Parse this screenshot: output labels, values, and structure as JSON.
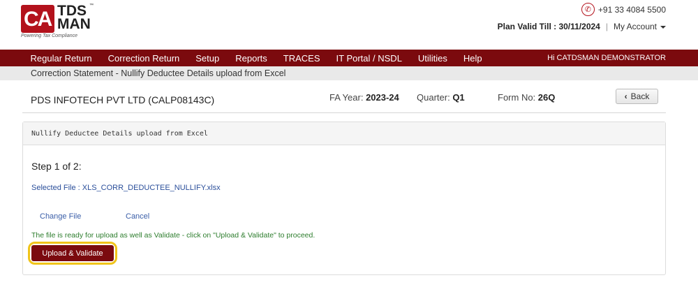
{
  "brand": {
    "logo_ca": "CA",
    "logo_tds": "TDS",
    "logo_man": "MAN",
    "trademark": "™",
    "tagline": "Powering Tax Compliance"
  },
  "header": {
    "phone": "+91 33 4084 5500",
    "plan_label": "Plan Valid Till : 30/11/2024",
    "separator": "|",
    "account_label": "My Account"
  },
  "nav": {
    "items": [
      {
        "label": "Regular Return"
      },
      {
        "label": "Correction Return"
      },
      {
        "label": "Setup"
      },
      {
        "label": "Reports"
      },
      {
        "label": "TRACES"
      },
      {
        "label": "IT Portal / NSDL"
      },
      {
        "label": "Utilities"
      },
      {
        "label": "Help"
      }
    ],
    "user_greeting": "Hi CATDSMAN DEMONSTRATOR"
  },
  "breadcrumb": "Correction Statement - Nullify Deductee Details upload from Excel",
  "company": {
    "name": "PDS INFOTECH PVT LTD (CALP08143C)",
    "fa_year_label": "FA Year:",
    "fa_year_value": "2023-24",
    "quarter_label": "Quarter:",
    "quarter_value": "Q1",
    "form_label": "Form No:",
    "form_value": "26Q",
    "back_label": "Back"
  },
  "panel": {
    "title": "Nullify Deductee Details upload from Excel",
    "step": "Step 1 of 2:",
    "selected_file": "Selected File : XLS_CORR_DEDUCTEE_NULLIFY.xlsx",
    "change_file": "Change File",
    "cancel": "Cancel",
    "ready_message": "The file is ready for upload as well as Validate - click on \"Upload & Validate\" to proceed.",
    "upload_button": "Upload & Validate"
  },
  "colors": {
    "brand_red": "#b3121c",
    "nav_maroon": "#7b0a0e",
    "highlight": "#f0c419",
    "success_text": "#2d7d2d",
    "link": "#3a5ea8"
  }
}
